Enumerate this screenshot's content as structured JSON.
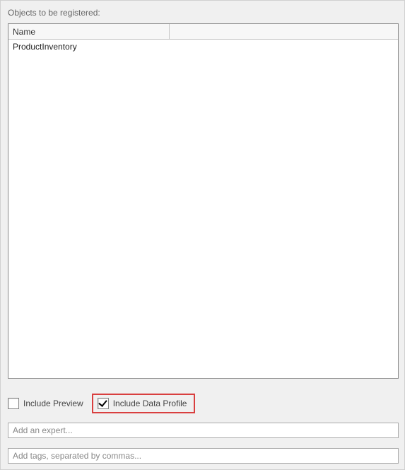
{
  "heading": "Objects to be registered:",
  "table": {
    "columns": {
      "name": "Name"
    },
    "rows": [
      {
        "name": "ProductInventory"
      }
    ]
  },
  "options": {
    "include_preview": {
      "label": "Include Preview",
      "checked": false
    },
    "include_data_profile": {
      "label": "Include Data Profile",
      "checked": true
    }
  },
  "inputs": {
    "expert": {
      "placeholder": "Add an expert...",
      "value": ""
    },
    "tags": {
      "placeholder": "Add tags, separated by commas...",
      "value": ""
    }
  }
}
